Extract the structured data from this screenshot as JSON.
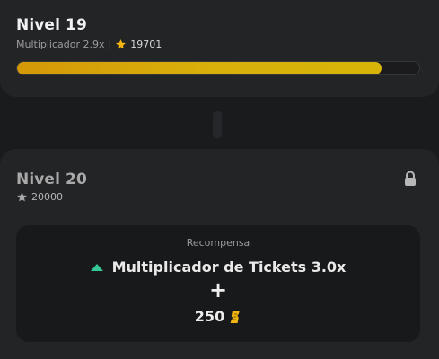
{
  "current_level": {
    "title": "Nivel 19",
    "multiplier_text": "Multiplicador 2.9x",
    "separator": "|",
    "points": "19701",
    "progress_fraction": 0.907
  },
  "next_level": {
    "title": "Nivel 20",
    "points": "20000",
    "locked": true,
    "reward": {
      "label": "Recompensa",
      "multiplier_reward": "Multiplicador de Tickets 3.0x",
      "plus": "+",
      "tickets": "250"
    }
  },
  "colors": {
    "accent_gold": "#d6b508",
    "star": "#f2b614",
    "up_arrow": "#35c796",
    "ticket": "#f0b50e"
  },
  "icons": {
    "star": "star-icon",
    "lock": "lock-icon",
    "arrow": "arrow-up-icon",
    "ticket": "ticket-icon"
  }
}
